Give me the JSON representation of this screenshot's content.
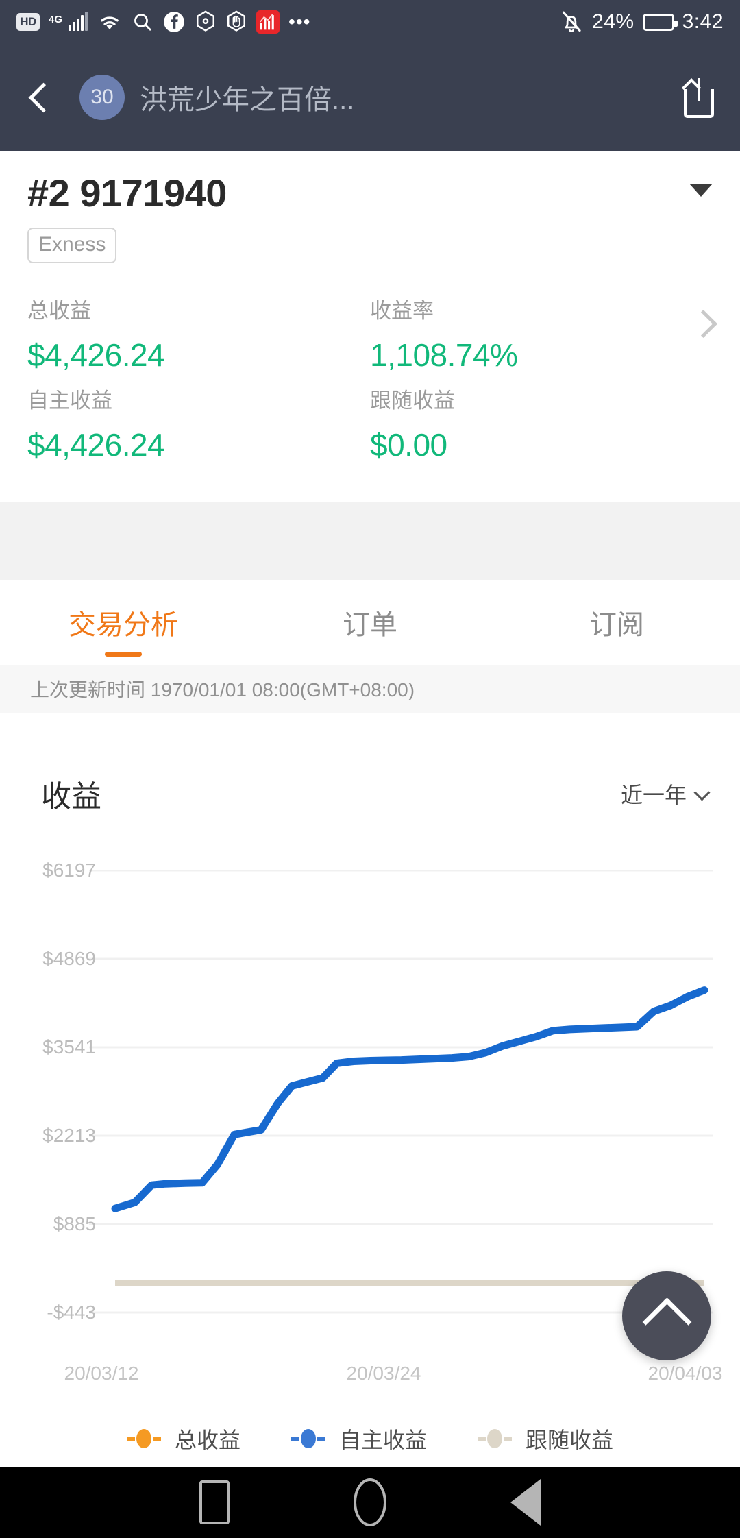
{
  "status_bar": {
    "hd_label": "HD",
    "network": "4G",
    "icons": [
      "hd-icon",
      "network-4g-icon",
      "signal-bars-icon",
      "wifi-icon",
      "search-icon",
      "facebook-icon",
      "hexagon-dot-icon",
      "hand-icon",
      "stock-app-icon",
      "more-dots-icon",
      "mute-bell-icon"
    ],
    "battery_percent": "24%",
    "time": "3:42",
    "more": "•••"
  },
  "nav_bar": {
    "back_icon": "back-chevron-icon",
    "avatar_badge": "30",
    "title": "洪荒少年之百倍...",
    "share_icon": "share-icon"
  },
  "account": {
    "id": "#2 9171940",
    "broker_tag": "Exness",
    "dropdown_icon": "caret-down-icon",
    "detail_chevron_icon": "chevron-right-icon",
    "stats": [
      {
        "label": "总收益",
        "value": "$4,426.24"
      },
      {
        "label": "收益率",
        "value": "1,108.74%"
      },
      {
        "label": "自主收益",
        "value": "$4,426.24"
      },
      {
        "label": "跟随收益",
        "value": "$0.00"
      }
    ],
    "value_color": "#11b87a"
  },
  "tabs": {
    "items": [
      {
        "label": "交易分析",
        "active": true
      },
      {
        "label": "订单",
        "active": false
      },
      {
        "label": "订阅",
        "active": false
      }
    ],
    "active_color": "#f07818",
    "inactive_color": "#8c8c8c"
  },
  "updated_text": "上次更新时间 1970/01/01 08:00(GMT+08:00)",
  "chart_header": {
    "title": "收益",
    "period_label": "近一年",
    "period_chevron_icon": "chevron-down-icon"
  },
  "fab": {
    "icon": "chevron-up-icon",
    "color": "#4b4d59"
  },
  "legend": [
    {
      "label": "总收益",
      "color": "#f59a23"
    },
    {
      "label": "自主收益",
      "color": "#3a79d4"
    },
    {
      "label": "跟随收益",
      "color": "#ddd6c8"
    }
  ],
  "android_nav": {
    "items": [
      "recents-square-icon",
      "home-circle-icon",
      "back-triangle-icon"
    ]
  },
  "chart_data": {
    "type": "line",
    "title": "收益",
    "xlabel": "",
    "ylabel": "",
    "grid": true,
    "legend_position": "bottom",
    "ylim": [
      -443,
      6197
    ],
    "yticks": [
      -443,
      885,
      2213,
      3541,
      4869,
      6197
    ],
    "ytick_labels": [
      "-$443",
      "$885",
      "$2213",
      "$3541",
      "$4869",
      "$6197"
    ],
    "xticks": [
      "20/03/12",
      "20/03/24",
      "20/04/03"
    ],
    "x_range": [
      "20/03/12",
      "20/04/03"
    ],
    "series": [
      {
        "name": "总收益",
        "color": "#f59a23",
        "values": []
      },
      {
        "name": "自主收益",
        "color": "#3a79d4",
        "x": [
          0,
          1.4,
          2.6,
          3.6,
          5.0,
          6.2,
          7.3,
          8.5,
          9.3,
          10.4,
          11.6,
          12.6,
          13.7,
          14.8,
          15.8,
          17.0,
          18.2,
          19.3,
          20.4,
          21.6,
          22.8,
          24.0,
          25.2,
          26.4,
          27.6,
          28.8,
          30.0,
          31.2,
          32.4,
          33.6,
          34.8,
          36.0,
          37.2,
          38.4,
          39.6,
          40.8,
          42.0
        ],
        "values": [
          1120,
          1210,
          1470,
          1490,
          1500,
          1505,
          1780,
          2230,
          2260,
          2300,
          2700,
          2960,
          3020,
          3080,
          3300,
          3330,
          3340,
          3345,
          3350,
          3360,
          3370,
          3380,
          3400,
          3460,
          3560,
          3630,
          3700,
          3790,
          3810,
          3820,
          3830,
          3840,
          3850,
          4080,
          4170,
          4300,
          4400
        ]
      },
      {
        "name": "跟随收益",
        "color": "#ddd6c8",
        "constant": 0,
        "values": [
          0,
          0,
          0,
          0,
          0,
          0,
          0,
          0,
          0,
          0,
          0,
          0,
          0,
          0,
          0,
          0,
          0,
          0,
          0,
          0,
          0,
          0,
          0,
          0,
          0,
          0,
          0,
          0,
          0,
          0,
          0,
          0,
          0,
          0,
          0,
          0,
          0
        ]
      }
    ]
  }
}
